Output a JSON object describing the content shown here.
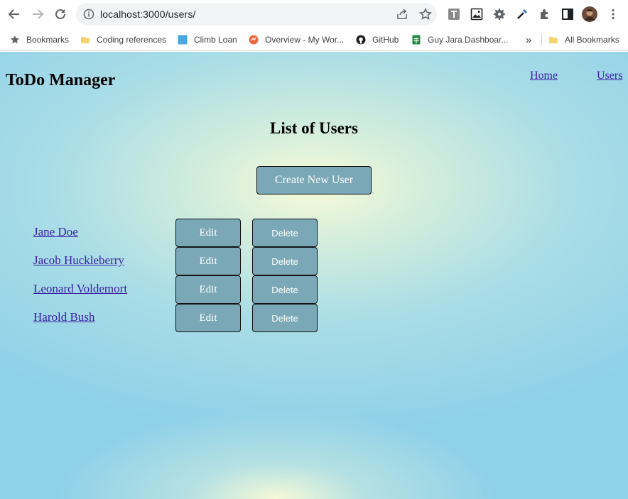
{
  "browser": {
    "url": "localhost:3000/users/",
    "bookmarks": [
      {
        "label": "Bookmarks",
        "icon": "star-icon"
      },
      {
        "label": "Coding references",
        "icon": "folder-icon"
      },
      {
        "label": "Climb Loan",
        "icon": "blue-square-icon"
      },
      {
        "label": "Overview - My Wor...",
        "icon": "orange-circle-icon"
      },
      {
        "label": "GitHub",
        "icon": "github-icon"
      },
      {
        "label": "Guy Jara Dashboar...",
        "icon": "sheets-icon"
      },
      {
        "label": "All Bookmarks",
        "icon": "folder-icon"
      }
    ],
    "overflow_label": "»"
  },
  "header": {
    "title": "ToDo Manager",
    "nav": [
      "Home",
      "Users"
    ]
  },
  "main": {
    "heading": "List of Users",
    "create_button": "Create New User",
    "edit_label": "Edit",
    "delete_label": "Delete",
    "users": [
      "Jane Doe",
      "Jacob Huckleberry",
      "Leonard Voldemort",
      "Harold Bush"
    ]
  },
  "colors": {
    "button_bg": "#7aa8b6",
    "link": "#3b1fa6",
    "page_bg": "#8fd1e9"
  }
}
